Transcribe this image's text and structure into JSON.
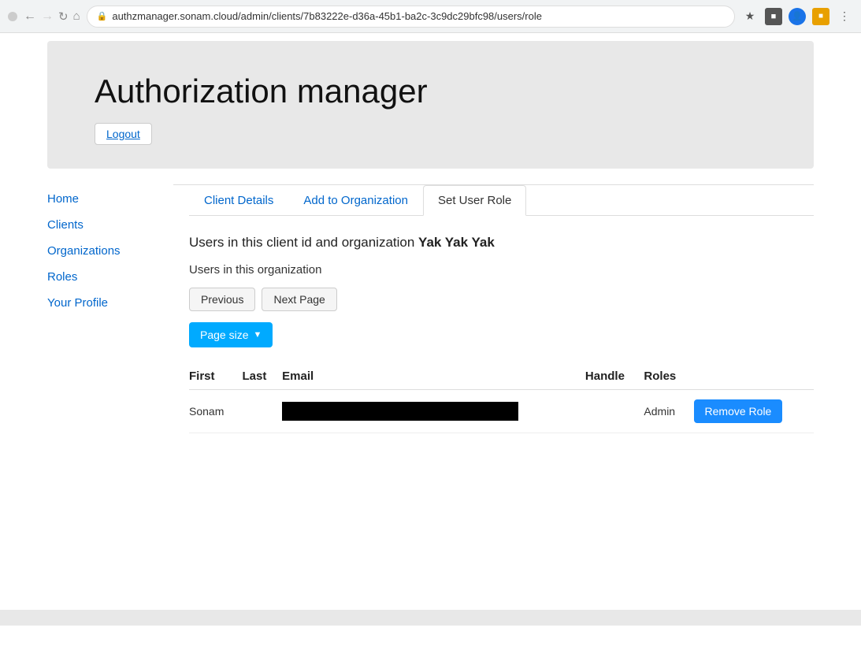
{
  "browser": {
    "url": "authzmanager.sonam.cloud/admin/clients/7b83222e-d36a-45b1-ba2c-3c9dc29bfc98/users/role",
    "favicon": "⚙"
  },
  "header": {
    "title": "Authorization manager",
    "logout_label": "Logout"
  },
  "sidebar": {
    "items": [
      {
        "label": "Home",
        "id": "home"
      },
      {
        "label": "Clients",
        "id": "clients"
      },
      {
        "label": "Organizations",
        "id": "organizations"
      },
      {
        "label": "Roles",
        "id": "roles"
      },
      {
        "label": "Your Profile",
        "id": "your-profile"
      }
    ]
  },
  "tabs": [
    {
      "label": "Client Details",
      "active": false
    },
    {
      "label": "Add to Organization",
      "active": false
    },
    {
      "label": "Set User Role",
      "active": true
    }
  ],
  "content": {
    "section_title_prefix": "Users in this client id and organization ",
    "organization_name": "Yak Yak Yak",
    "sub_label": "Users in this organization",
    "previous_btn": "Previous",
    "next_page_btn": "Next Page",
    "page_size_label": "Page size",
    "table": {
      "columns": [
        "First",
        "Last",
        "Email",
        "Handle",
        "Roles"
      ],
      "rows": [
        {
          "first": "Sonam",
          "last": "",
          "email": "",
          "handle": "",
          "roles": "Admin",
          "email_redacted": true
        }
      ]
    },
    "remove_role_label": "Remove Role"
  }
}
